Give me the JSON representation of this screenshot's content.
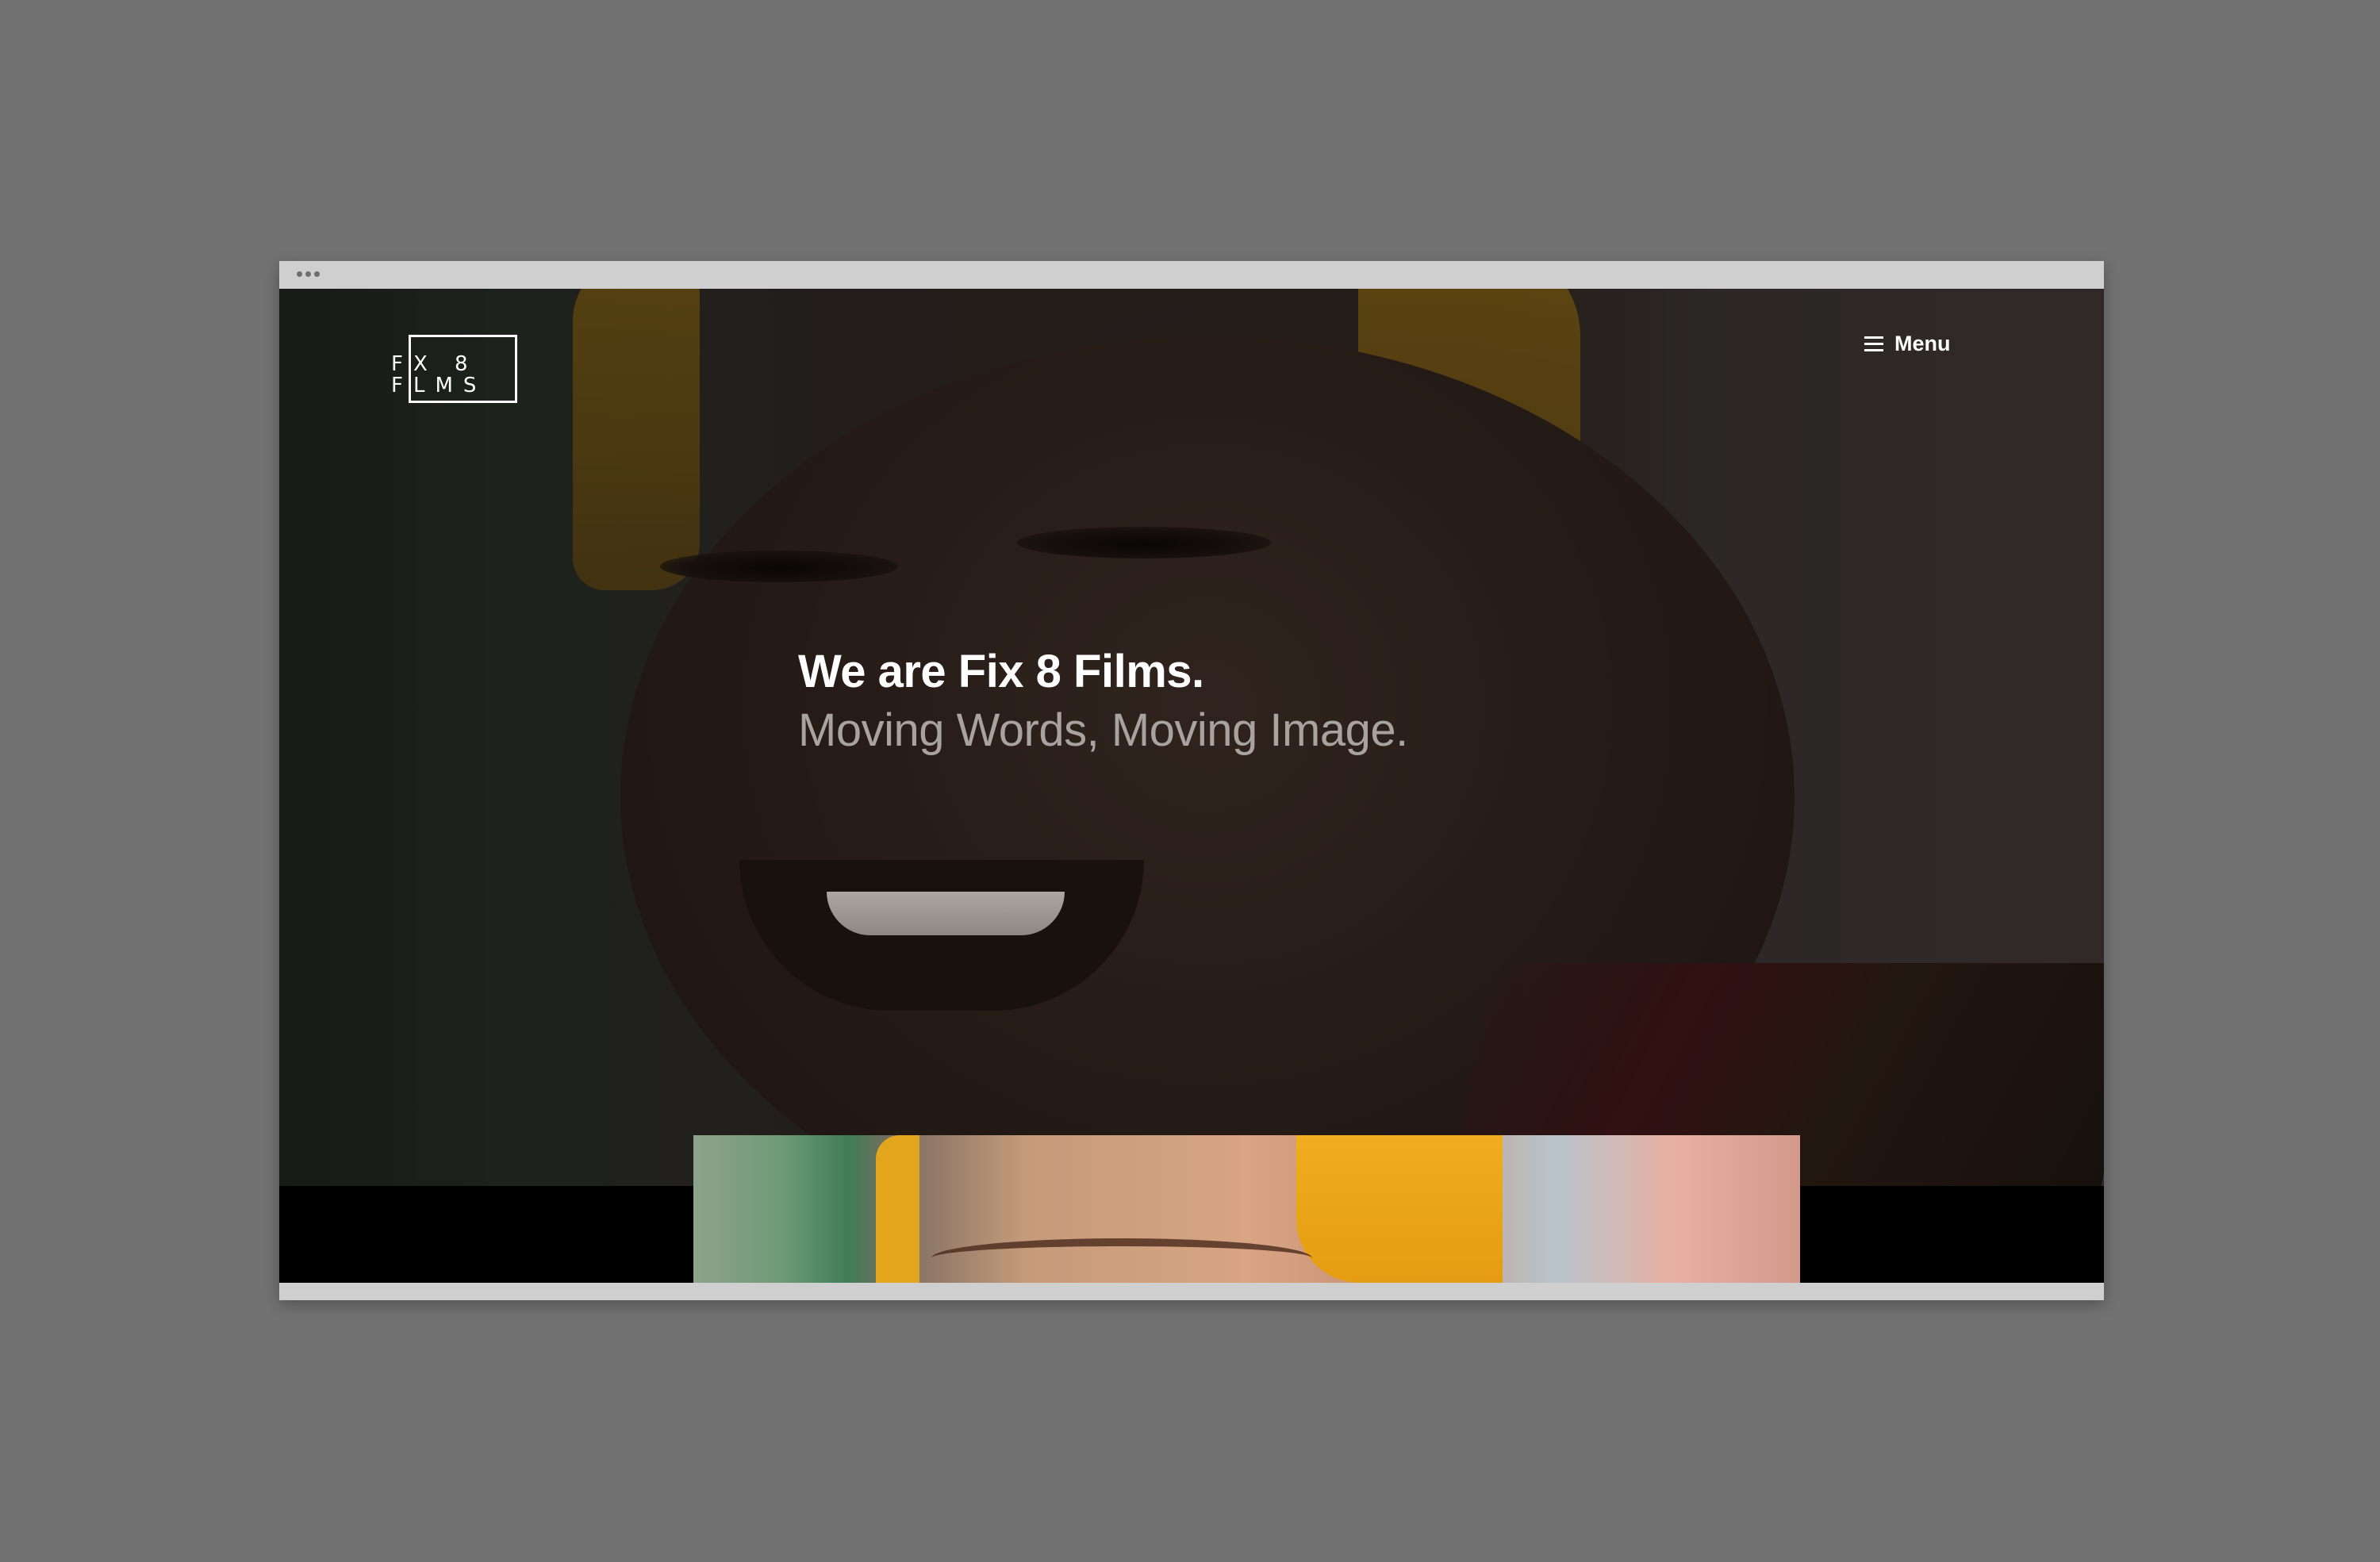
{
  "logo": {
    "line1": "FX 8",
    "line2": "FLMS"
  },
  "nav": {
    "menu_label": "Menu",
    "menu_icon": "hamburger-icon"
  },
  "hero": {
    "headline": "We are Fix 8 Films.",
    "subheadline": "Moving Words, Moving Image."
  },
  "colors": {
    "page_background": "#727272",
    "browser_chrome": "#cfcfcf",
    "headline": "#ffffff",
    "subheadline": "#a9a3a0",
    "accent_yellow": "#e2a51c"
  }
}
